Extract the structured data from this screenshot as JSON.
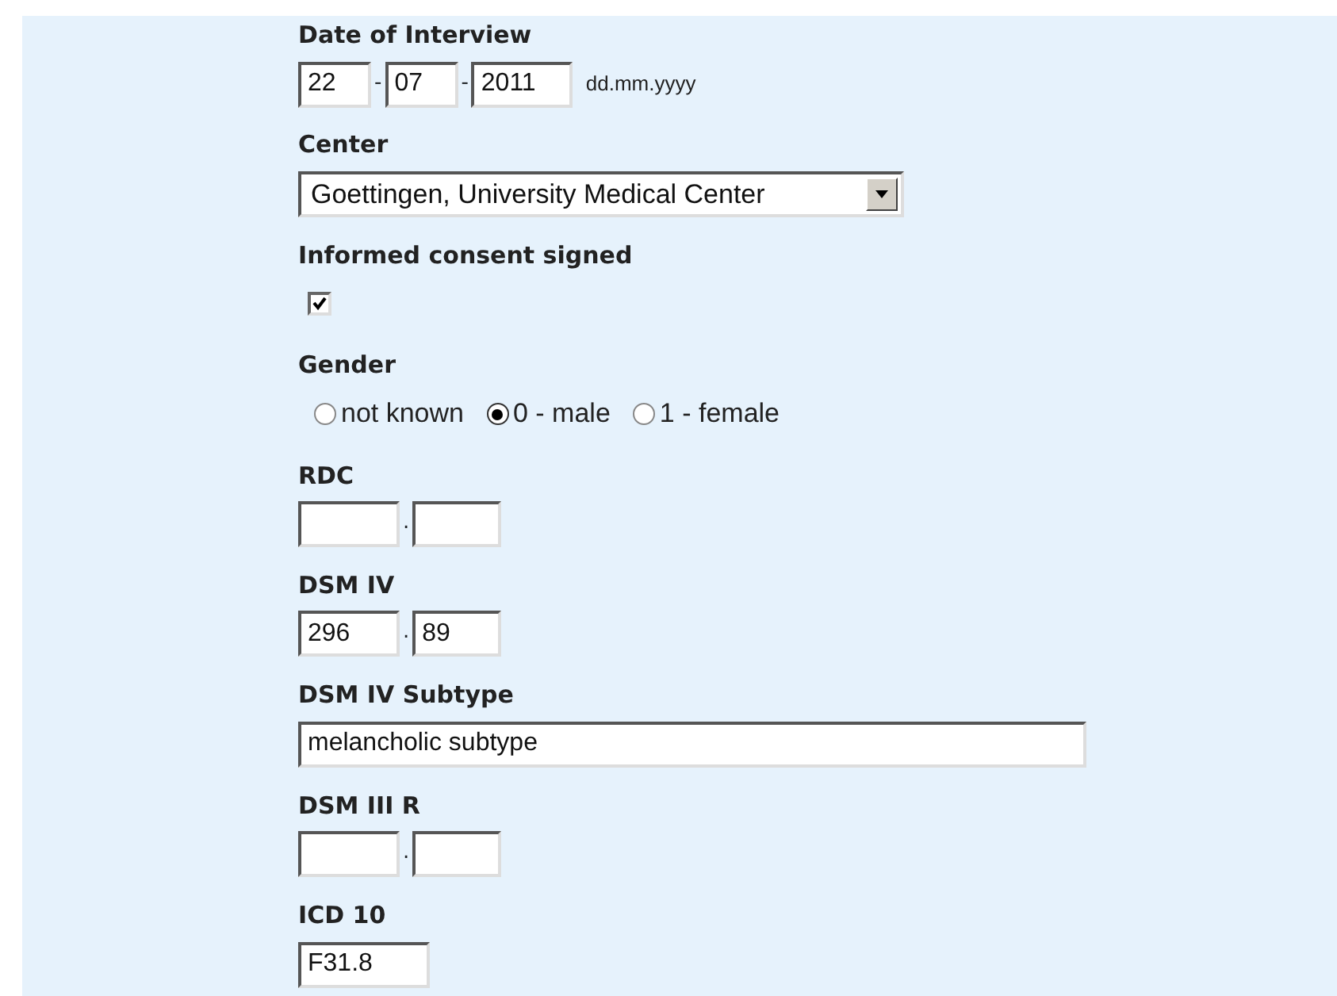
{
  "fields": [
    {
      "kind": "date",
      "label": "Date of Interview",
      "parts": [
        {
          "value": "22"
        },
        {
          "sep": "-",
          "value": "07"
        },
        {
          "sep": "-",
          "value": "2011"
        }
      ],
      "hint": "dd.mm.yyyy"
    },
    {
      "kind": "select",
      "label": "Center",
      "value": "Goettingen, University Medical Center"
    },
    {
      "kind": "checkbox",
      "label": "Informed consent signed",
      "checked": true
    },
    {
      "kind": "radio",
      "label": "Gender",
      "options": [
        {
          "label": "not known",
          "selected": false
        },
        {
          "label": "0 - male",
          "selected": true
        },
        {
          "label": "1 - female",
          "selected": false
        }
      ]
    },
    {
      "kind": "code",
      "label": "RDC",
      "separator": "."
    },
    {
      "kind": "code",
      "label": "DSM IV",
      "separator": ".",
      "values": [
        "296",
        "89"
      ]
    },
    {
      "kind": "longtext",
      "label": "DSM IV Subtype",
      "value": "melancholic subtype"
    },
    {
      "kind": "code",
      "label": "DSM III R",
      "separator": "."
    },
    {
      "kind": "shorttext",
      "label": "ICD 10",
      "value": "F31.8"
    }
  ]
}
